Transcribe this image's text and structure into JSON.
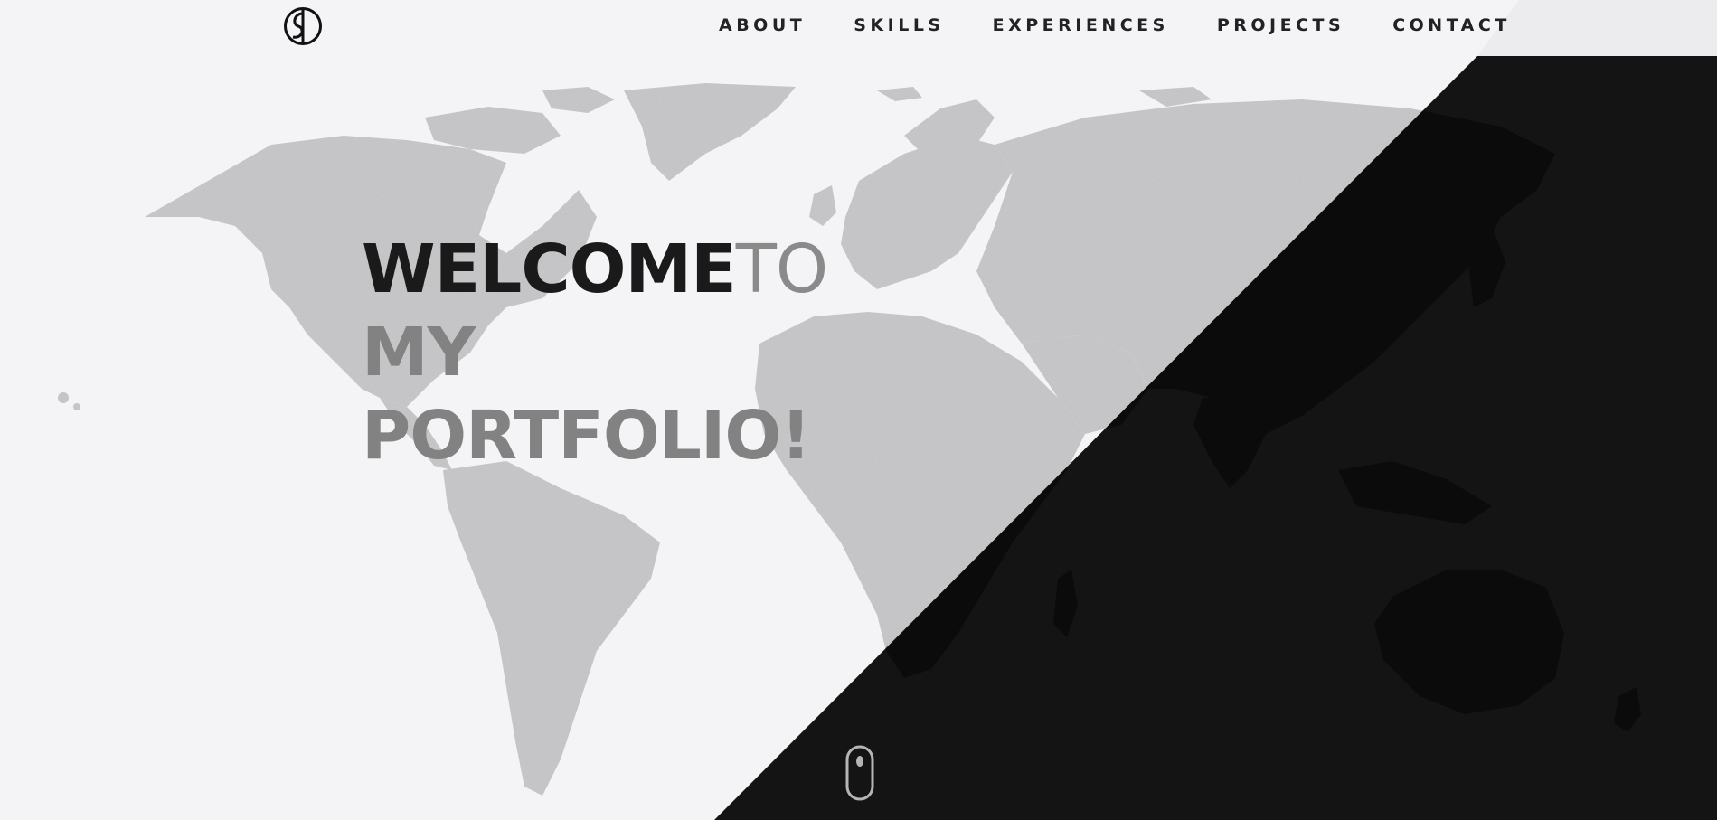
{
  "logo": {
    "icon": "sd-monogram-icon"
  },
  "nav": {
    "items": [
      {
        "label": "ABOUT"
      },
      {
        "label": "SKILLS"
      },
      {
        "label": "EXPERIENCES"
      },
      {
        "label": "PROJECTS"
      },
      {
        "label": "CONTACT"
      }
    ]
  },
  "hero": {
    "line1_bold": "WELCOME",
    "line1_thin": "TO",
    "line2": "MY",
    "line3": "PORTFOLIO!"
  },
  "colors": {
    "background_light": "#f4f4f6",
    "background_dark": "#141414",
    "map_light": "#c9c9cb",
    "map_dark": "#0d0d0d",
    "text_dark": "#1a1a1a",
    "text_gray": "#828282"
  },
  "scroll_indicator": {
    "icon": "mouse-scroll-icon"
  }
}
